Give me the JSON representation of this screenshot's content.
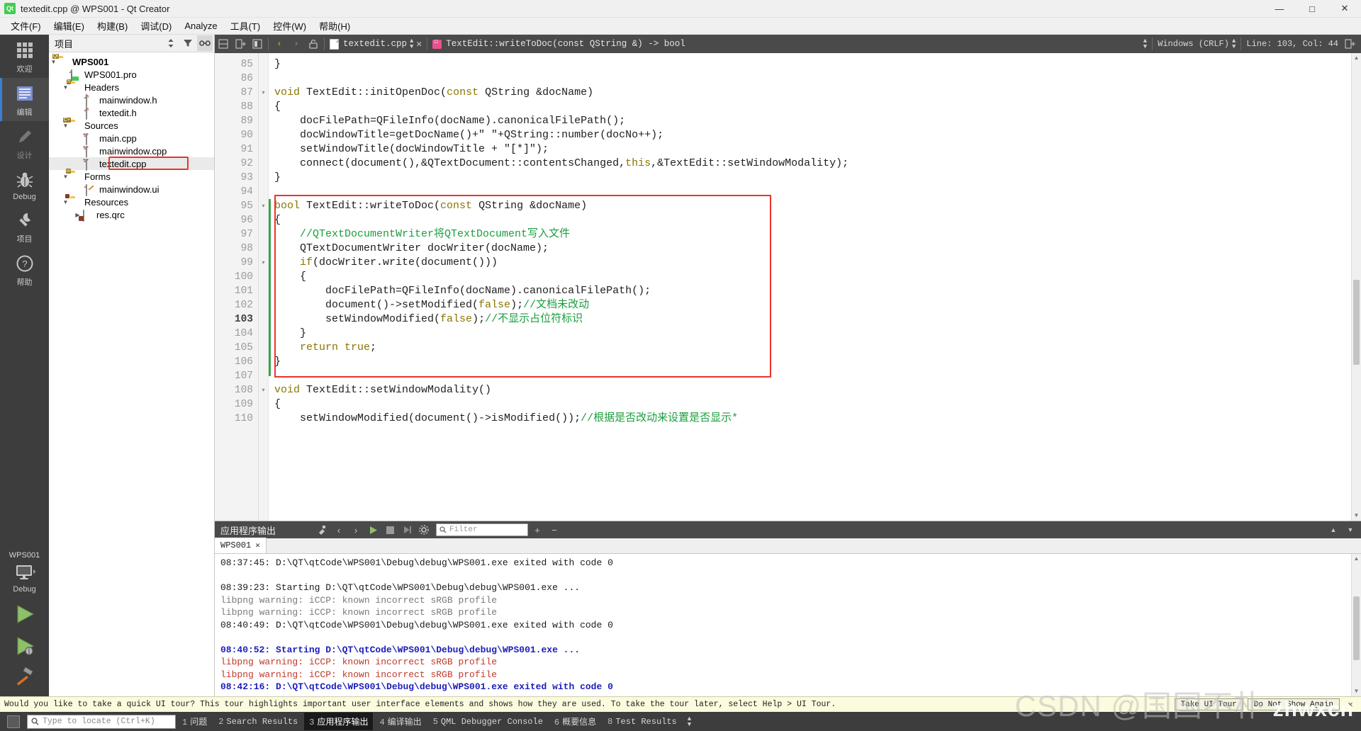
{
  "window": {
    "title": "textedit.cpp @ WPS001 - Qt Creator",
    "app_icon": "qt-logo-icon",
    "minimize": "—",
    "maximize": "□",
    "close": "✕"
  },
  "menubar": {
    "items": [
      {
        "label": "文件(F)",
        "name": "menu-file"
      },
      {
        "label": "编辑(E)",
        "name": "menu-edit"
      },
      {
        "label": "构建(B)",
        "name": "menu-build"
      },
      {
        "label": "调试(D)",
        "name": "menu-debug"
      },
      {
        "label": "Analyze",
        "name": "menu-analyze"
      },
      {
        "label": "工具(T)",
        "name": "menu-tools"
      },
      {
        "label": "控件(W)",
        "name": "menu-window"
      },
      {
        "label": "帮助(H)",
        "name": "menu-help"
      }
    ]
  },
  "modebar": {
    "modes": [
      {
        "label": "欢迎",
        "name": "mode-welcome",
        "icon": "grid-icon"
      },
      {
        "label": "编辑",
        "name": "mode-edit",
        "icon": "lines-icon"
      },
      {
        "label": "设计",
        "name": "mode-design",
        "icon": "pencil-icon"
      },
      {
        "label": "Debug",
        "name": "mode-debug",
        "icon": "bug-icon"
      },
      {
        "label": "项目",
        "name": "mode-projects",
        "icon": "wrench-icon"
      },
      {
        "label": "帮助",
        "name": "mode-help",
        "icon": "question-icon"
      }
    ],
    "kit_project": "WPS001",
    "kit_config": "Debug",
    "run_label": "run-button",
    "debug_label": "run-debug-button",
    "build_label": "build-button"
  },
  "project_pane": {
    "title": "项目",
    "tools": [
      "sync-icon",
      "filter-icon",
      "link-icon"
    ],
    "tree": [
      {
        "label": "WPS001",
        "icon": "qt-project-folder-icon",
        "depth": 0,
        "arrow": "down",
        "bold": true
      },
      {
        "label": "WPS001.pro",
        "icon": "qt-pro-file-icon",
        "depth": 1,
        "arrow": "none",
        "bold": false
      },
      {
        "label": "Headers",
        "icon": "folder-h-icon",
        "depth": 1,
        "arrow": "down",
        "bold": false
      },
      {
        "label": "mainwindow.h",
        "icon": "header-file-icon",
        "depth": 2,
        "arrow": "none",
        "bold": false
      },
      {
        "label": "textedit.h",
        "icon": "header-file-icon",
        "depth": 2,
        "arrow": "none",
        "bold": false
      },
      {
        "label": "Sources",
        "icon": "folder-cpp-icon",
        "depth": 1,
        "arrow": "down",
        "bold": false
      },
      {
        "label": "main.cpp",
        "icon": "source-file-icon",
        "depth": 2,
        "arrow": "none",
        "bold": false
      },
      {
        "label": "mainwindow.cpp",
        "icon": "source-file-icon",
        "depth": 2,
        "arrow": "none",
        "bold": false
      },
      {
        "label": "textedit.cpp",
        "icon": "source-file-icon",
        "depth": 2,
        "arrow": "none",
        "bold": false,
        "selected": true,
        "highlighted": true
      },
      {
        "label": "Forms",
        "icon": "folder-ui-icon",
        "depth": 1,
        "arrow": "down",
        "bold": false
      },
      {
        "label": "mainwindow.ui",
        "icon": "ui-file-icon",
        "depth": 2,
        "arrow": "none",
        "bold": false
      },
      {
        "label": "Resources",
        "icon": "folder-res-icon",
        "depth": 1,
        "arrow": "down",
        "bold": false
      },
      {
        "label": "res.qrc",
        "icon": "qrc-file-icon",
        "depth": 2,
        "arrow": "right",
        "bold": false
      }
    ]
  },
  "editor_toolbar": {
    "back_icon": "back-arrow-icon",
    "forward_icon": "forward-arrow-icon",
    "lock_icon": "unlocked-icon",
    "split_icon": "split-icon",
    "close_split_icon": "close-split-icon",
    "file_name": "textedit.cpp",
    "symbol": "TextEdit::writeToDoc(const QString &) -> bool",
    "close_label": "✕",
    "line_ending": "Windows (CRLF)",
    "cursor_position": "Line: 103, Col: 44",
    "split_button": "split-editor-button"
  },
  "code": {
    "highlight_box_label": "red-highlight-box",
    "lines": [
      {
        "no": "85",
        "fold": "",
        "segments": [
          {
            "t": "}",
            "c": "txt"
          }
        ]
      },
      {
        "no": "86",
        "fold": "",
        "segments": []
      },
      {
        "no": "87",
        "fold": "▾",
        "segments": [
          {
            "t": "void ",
            "c": "kw"
          },
          {
            "t": "TextEdit::initOpenDoc(",
            "c": "txt"
          },
          {
            "t": "const ",
            "c": "kw"
          },
          {
            "t": "QString &docName)",
            "c": "txt"
          }
        ]
      },
      {
        "no": "88",
        "fold": "",
        "segments": [
          {
            "t": "{",
            "c": "txt"
          }
        ]
      },
      {
        "no": "89",
        "fold": "",
        "segments": [
          {
            "t": "    docFilePath=QFileInfo(docName).canonicalFilePath();",
            "c": "txt"
          }
        ]
      },
      {
        "no": "90",
        "fold": "",
        "segments": [
          {
            "t": "    docWindowTitle=getDocName()+\" \"+QString::number(docNo++);",
            "c": "txt"
          }
        ]
      },
      {
        "no": "91",
        "fold": "",
        "segments": [
          {
            "t": "    setWindowTitle(docWindowTitle + \"[*]\");",
            "c": "txt"
          }
        ]
      },
      {
        "no": "92",
        "fold": "",
        "segments": [
          {
            "t": "    connect(document(),&QTextDocument::contentsChanged,",
            "c": "txt"
          },
          {
            "t": "this",
            "c": "kw"
          },
          {
            "t": ",&TextEdit::setWindowModality);",
            "c": "txt"
          }
        ]
      },
      {
        "no": "93",
        "fold": "",
        "segments": [
          {
            "t": "}",
            "c": "txt"
          }
        ]
      },
      {
        "no": "94",
        "fold": "",
        "segments": []
      },
      {
        "no": "95",
        "fold": "▾",
        "segments": [
          {
            "t": "bool ",
            "c": "kw"
          },
          {
            "t": "TextEdit::writeToDoc(",
            "c": "txt"
          },
          {
            "t": "const ",
            "c": "kw"
          },
          {
            "t": "QString &docName)",
            "c": "txt"
          }
        ]
      },
      {
        "no": "96",
        "fold": "",
        "segments": [
          {
            "t": "{",
            "c": "txt"
          }
        ]
      },
      {
        "no": "97",
        "fold": "",
        "segments": [
          {
            "t": "    //QTextDocumentWriter将QTextDocument写入文件",
            "c": "cmt"
          }
        ]
      },
      {
        "no": "98",
        "fold": "",
        "segments": [
          {
            "t": "    QTextDocumentWriter docWriter(docName);",
            "c": "txt"
          }
        ]
      },
      {
        "no": "99",
        "fold": "▾",
        "segments": [
          {
            "t": "    if",
            "c": "kw"
          },
          {
            "t": "(docWriter.write(document()))",
            "c": "txt"
          }
        ]
      },
      {
        "no": "100",
        "fold": "",
        "segments": [
          {
            "t": "    {",
            "c": "txt"
          }
        ]
      },
      {
        "no": "101",
        "fold": "",
        "segments": [
          {
            "t": "        docFilePath=QFileInfo(docName).canonicalFilePath();",
            "c": "txt"
          }
        ]
      },
      {
        "no": "102",
        "fold": "",
        "segments": [
          {
            "t": "        document()->setModified(",
            "c": "txt"
          },
          {
            "t": "false",
            "c": "kw"
          },
          {
            "t": ");",
            "c": "txt"
          },
          {
            "t": "//文档未改动",
            "c": "cmt"
          }
        ]
      },
      {
        "no": "103",
        "fold": "",
        "current": true,
        "segments": [
          {
            "t": "        setWindowModified(",
            "c": "txt"
          },
          {
            "t": "false",
            "c": "kw"
          },
          {
            "t": ");",
            "c": "txt"
          },
          {
            "t": "//不显示占位符标识",
            "c": "cmt"
          }
        ]
      },
      {
        "no": "104",
        "fold": "",
        "segments": [
          {
            "t": "    }",
            "c": "txt"
          }
        ]
      },
      {
        "no": "105",
        "fold": "",
        "segments": [
          {
            "t": "    ",
            "c": "txt"
          },
          {
            "t": "return true",
            "c": "kw"
          },
          {
            "t": ";",
            "c": "txt"
          }
        ]
      },
      {
        "no": "106",
        "fold": "",
        "segments": [
          {
            "t": "}",
            "c": "txt"
          }
        ]
      },
      {
        "no": "107",
        "fold": "",
        "segments": []
      },
      {
        "no": "108",
        "fold": "▾",
        "segments": [
          {
            "t": "void ",
            "c": "kw"
          },
          {
            "t": "TextEdit::setWindowModality()",
            "c": "txt"
          }
        ]
      },
      {
        "no": "109",
        "fold": "",
        "segments": [
          {
            "t": "{",
            "c": "txt"
          }
        ]
      },
      {
        "no": "110",
        "fold": "",
        "segments": [
          {
            "t": "    setWindowModified(document()->isModified());",
            "c": "txt"
          },
          {
            "t": "//根据是否改动来设置是否显示*",
            "c": "cmt"
          }
        ]
      }
    ]
  },
  "output_pane": {
    "title": "应用程序输出",
    "toolbar_icons": [
      "clear-icon",
      "prev-item-icon",
      "next-item-icon",
      "run-icon",
      "stop-icon",
      "attach-icon",
      "settings-icon"
    ],
    "filter_placeholder": "Filter",
    "zoom_in": "+",
    "zoom_out": "−",
    "maximize_icon": "▲",
    "minimize_icon": "▼",
    "tabs": [
      {
        "label": "WPS001",
        "close": "✕"
      }
    ],
    "log": [
      {
        "text": "08:37:45: D:\\QT\\qtCode\\WPS001\\Debug\\debug\\WPS001.exe exited with code 0",
        "style": "black"
      },
      {
        "text": "",
        "style": "black"
      },
      {
        "text": "08:39:23: Starting D:\\QT\\qtCode\\WPS001\\Debug\\debug\\WPS001.exe ...",
        "style": "black"
      },
      {
        "text": "libpng warning: iCCP: known incorrect sRGB profile",
        "style": "gray"
      },
      {
        "text": "libpng warning: iCCP: known incorrect sRGB profile",
        "style": "gray"
      },
      {
        "text": "08:40:49: D:\\QT\\qtCode\\WPS001\\Debug\\debug\\WPS001.exe exited with code 0",
        "style": "black"
      },
      {
        "text": "",
        "style": "black"
      },
      {
        "text": "08:40:52: Starting D:\\QT\\qtCode\\WPS001\\Debug\\debug\\WPS001.exe ...",
        "style": "blue"
      },
      {
        "text": "libpng warning: iCCP: known incorrect sRGB profile",
        "style": "red"
      },
      {
        "text": "libpng warning: iCCP: known incorrect sRGB profile",
        "style": "red"
      },
      {
        "text": "08:42:16: D:\\QT\\qtCode\\WPS001\\Debug\\debug\\WPS001.exe exited with code 0",
        "style": "blue"
      }
    ]
  },
  "tour_banner": {
    "message": "Would you like to take a quick UI tour? This tour highlights important user interface elements and shows how they are used. To take the tour later, select Help > UI Tour.",
    "take_tour": "Take UI Tour",
    "do_not_show": "Do Not Show Again",
    "close": "✕"
  },
  "statusbar": {
    "toggle_sidebar": "toggle-sidebar-icon",
    "locator_placeholder": "Type to locate (Ctrl+K)",
    "items": [
      {
        "num": "1",
        "label": "问题",
        "active": false
      },
      {
        "num": "2",
        "label": "Search Results",
        "active": false
      },
      {
        "num": "3",
        "label": "应用程序输出",
        "active": true
      },
      {
        "num": "4",
        "label": "编译输出",
        "active": false
      },
      {
        "num": "5",
        "label": "QML Debugger Console",
        "active": false
      },
      {
        "num": "6",
        "label": "概要信息",
        "active": false
      },
      {
        "num": "8",
        "label": "Test Results",
        "active": false
      }
    ]
  },
  "watermark": {
    "text": "CSDN @国国不朴",
    "text2": "zhwxcn"
  },
  "colors": {
    "accent": "#3a7fd5",
    "highlight_red": "#e8352b",
    "comment_green": "#1a9e3d",
    "keyword_gold": "#8a7600",
    "qt_green": "#41cd52",
    "panel_dark": "#4a4a4a",
    "mode_dark": "#3d3d3d"
  }
}
